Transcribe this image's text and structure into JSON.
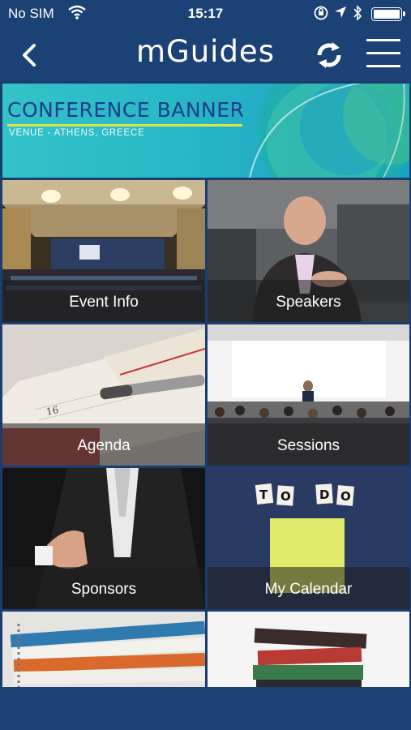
{
  "status_bar": {
    "carrier": "No SIM",
    "time": "15:17",
    "icons": [
      "wifi-icon",
      "rotation-lock-icon",
      "location-icon",
      "bluetooth-icon",
      "battery-icon"
    ]
  },
  "nav": {
    "title": "mGuides",
    "back_icon": "chevron-left-icon",
    "refresh_icon": "refresh-icon",
    "menu_icon": "hamburger-menu-icon"
  },
  "banner": {
    "title": "CONFERENCE BANNER",
    "subtitle": "VENUE - ATHENS, GREECE"
  },
  "tiles": [
    {
      "label": "Event Info"
    },
    {
      "label": "Speakers"
    },
    {
      "label": "Agenda"
    },
    {
      "label": "Sessions"
    },
    {
      "label": "Sponsors"
    },
    {
      "label": "My Calendar"
    },
    {
      "label": ""
    },
    {
      "label": ""
    }
  ],
  "calendar_note": {
    "letters": [
      "T",
      "O",
      "D",
      "O"
    ]
  },
  "colors": {
    "nav_background": "#1c4275",
    "banner_title": "#1e3c8c",
    "banner_accent": "#d9e64a"
  }
}
